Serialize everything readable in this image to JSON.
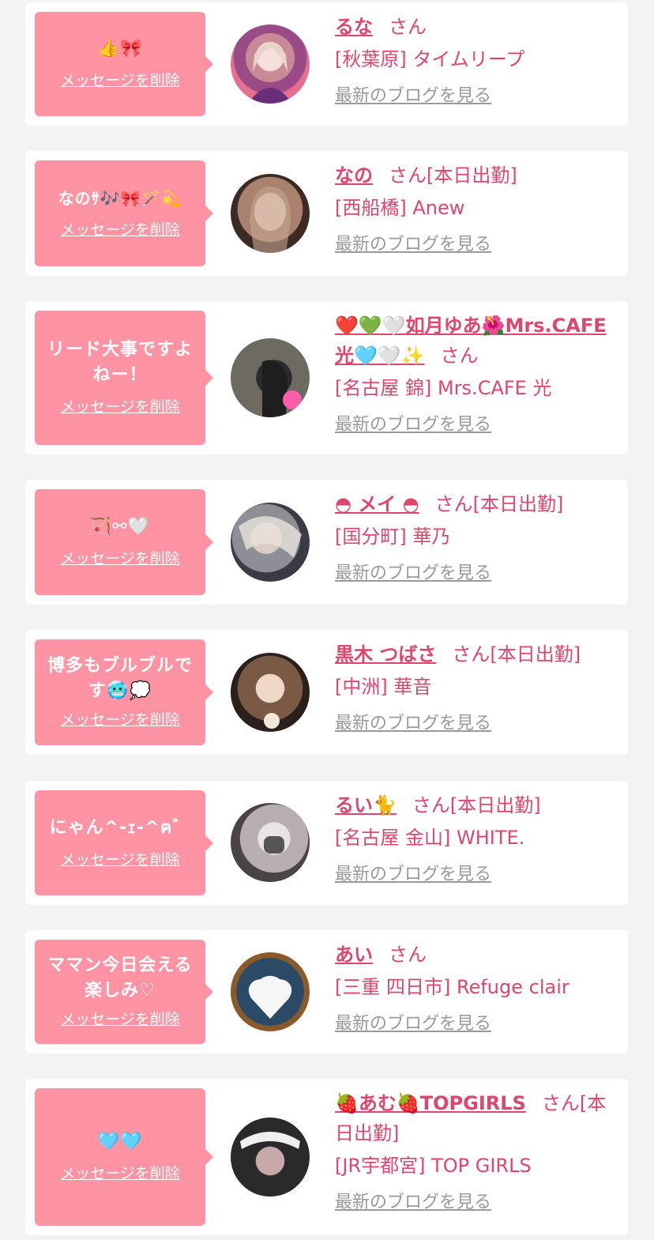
{
  "delete_label": "メッセージを削除",
  "san_label": "さん",
  "blog_label": "最新のブログを見る",
  "items": [
    {
      "message": "👍🎀",
      "name": "るな",
      "status": "",
      "shop": "[秋葉原] タイムリープ"
    },
    {
      "message": "なのｻ🎶🎀🪄💫",
      "name": "なの",
      "status": "[本日出勤]",
      "shop": "[西船橋] Anew"
    },
    {
      "message": "リード大事ですよねー！",
      "name": "❤️💚🤍如月ゆあ🌺Mrs.CAFE光🩵🤍✨",
      "status": "",
      "shop": "[名古屋 錦] Mrs.CAFE 光"
    },
    {
      "message": "🏹⚯🤍",
      "name": "◓ メイ ◓",
      "status": "[本日出勤]",
      "shop": "[国分町] 華乃"
    },
    {
      "message": "博多もブルブルです🥶💭",
      "name": "黒木 つばさ",
      "status": "[本日出勤]",
      "shop": "[中洲] 華音"
    },
    {
      "message": "にゃん^-ｪ-^ฅ゛",
      "name": "るい🐈",
      "status": "[本日出勤]",
      "shop": "[名古屋 金山] WHITE."
    },
    {
      "message": "ママン今日会える楽しみ♡",
      "name": "あい",
      "status": "",
      "shop": "[三重 四日市] Refuge clair"
    },
    {
      "message": "🩵🩵",
      "name": "🍓あむ🍓TOPGIRLS",
      "status": "[本日出勤]",
      "shop": "[JR宇都宮] TOP GIRLS"
    }
  ],
  "colors": {
    "bubble": "#fe93a3",
    "accent": "#e0466d",
    "link": "#9a9a9a",
    "background": "#f3f3f3"
  }
}
